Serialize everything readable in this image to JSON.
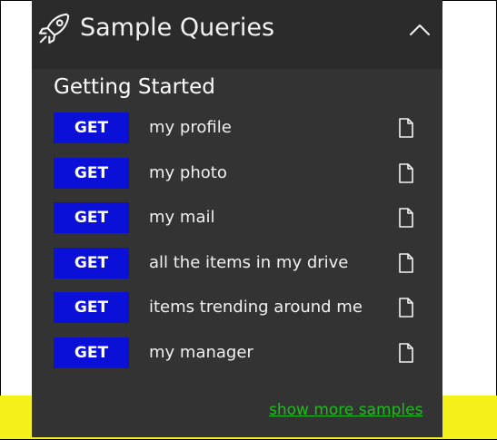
{
  "header": {
    "title": "Sample Queries",
    "icon": "rocket-icon",
    "toggle_icon": "chevron-up-icon"
  },
  "section": {
    "title": "Getting Started"
  },
  "queries": [
    {
      "method": "GET",
      "label": "my profile"
    },
    {
      "method": "GET",
      "label": "my photo"
    },
    {
      "method": "GET",
      "label": "my mail"
    },
    {
      "method": "GET",
      "label": "all the items in my drive"
    },
    {
      "method": "GET",
      "label": "items trending around me"
    },
    {
      "method": "GET",
      "label": "my manager"
    }
  ],
  "footer": {
    "show_more_label": "show more samples"
  },
  "colors": {
    "panel": "#333333",
    "header": "#2b2b2b",
    "get_badge": "#0a10d8",
    "link": "#19c019",
    "highlight": "#f4f21a"
  }
}
